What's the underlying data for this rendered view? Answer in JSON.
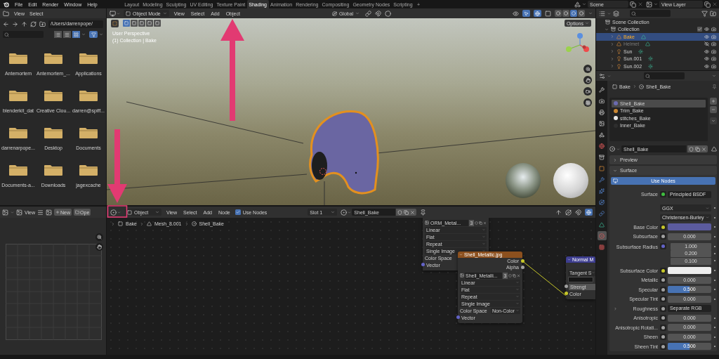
{
  "topbar": {
    "menu": [
      "File",
      "Edit",
      "Render",
      "Window",
      "Help"
    ],
    "workspaces": [
      {
        "label": "Layout",
        "selected": false
      },
      {
        "label": "Modeling",
        "selected": false
      },
      {
        "label": "Sculpting",
        "selected": false
      },
      {
        "label": "UV Editing",
        "selected": false
      },
      {
        "label": "Texture Paint",
        "selected": false
      },
      {
        "label": "Shading",
        "selected": true
      },
      {
        "label": "Animation",
        "selected": false
      },
      {
        "label": "Rendering",
        "selected": false
      },
      {
        "label": "Compositing",
        "selected": false
      },
      {
        "label": "Geometry Nodes",
        "selected": false
      },
      {
        "label": "Scripting",
        "selected": false
      }
    ],
    "add_workspace": "+",
    "scene": "Scene",
    "view_layer": "View Layer"
  },
  "file_browser": {
    "menu": [
      "View",
      "Select"
    ],
    "path": "/Users/darrenpope/",
    "display_modes": [
      {
        "selected": false
      },
      {
        "selected": false
      },
      {
        "selected": true
      }
    ],
    "filter_active": true,
    "items": [
      "Antemortem",
      "Antemortem_...",
      "Applications",
      "blenderkit_dat",
      "Creative Clou...",
      "darren@spiff...",
      "darrenarpope...",
      "Desktop",
      "Documents",
      "Documents-a...",
      "Downloads",
      "jagexcache"
    ]
  },
  "image_editor": {
    "menu": [
      "View"
    ],
    "new": "New",
    "open": "Ope"
  },
  "viewport": {
    "mode": "Object Mode",
    "menu": [
      "View",
      "Select",
      "Add",
      "Object"
    ],
    "orientation": "Global",
    "shading_modes": [
      {
        "selected": false
      },
      {
        "selected": false
      },
      {
        "selected": true
      },
      {
        "selected": false
      }
    ],
    "select_modes": [
      {
        "selected": true
      },
      {
        "selected": false
      },
      {
        "selected": false
      },
      {
        "selected": false
      },
      {
        "selected": false
      }
    ],
    "options": "Options",
    "info": [
      "User Perspective",
      "(1) Collection | Bake"
    ]
  },
  "node_editor": {
    "type": "Object",
    "menu": [
      "View",
      "Select",
      "Add",
      "Node"
    ],
    "use_nodes": {
      "label": "Use Nodes",
      "checked": true
    },
    "slot": "Slot 1",
    "material": "Shell_Bake",
    "breadcrumb": [
      "Bake",
      "Mesh_8.001",
      "Shell_Bake"
    ],
    "nodes": [
      {
        "rows": [
          {
            "kind": "image",
            "text": "ORM_Metal...",
            "users": "3"
          },
          {
            "kind": "dropdown",
            "text": "Linear"
          },
          {
            "kind": "dropdown",
            "text": "Flat"
          },
          {
            "kind": "dropdown",
            "text": "Repeat"
          },
          {
            "kind": "dropdown",
            "text": "Single Image"
          },
          {
            "kind": "label",
            "text": "Color Space"
          },
          {
            "kind": "input",
            "text": "Vector",
            "color": "#6363c7"
          }
        ]
      },
      {
        "title": "Shell_Metallic.jpg",
        "color": "#8c501e",
        "rows": [
          {
            "kind": "output",
            "text": "Color",
            "color": "#c7c729"
          },
          {
            "kind": "output",
            "text": "Alpha",
            "color": "#a1a1a1"
          },
          {
            "kind": "image",
            "text": "Shell_Metalli...",
            "users": "3"
          },
          {
            "kind": "dropdown",
            "text": "Linear"
          },
          {
            "kind": "dropdown",
            "text": "Flat"
          },
          {
            "kind": "dropdown",
            "text": "Repeat"
          },
          {
            "kind": "dropdown",
            "text": "Single Image"
          },
          {
            "kind": "field",
            "text": "Color Space",
            "value": "Non-Color"
          },
          {
            "kind": "input",
            "text": "Vector",
            "color": "#6363c7"
          }
        ]
      },
      {
        "title": "Normal M",
        "color": "#3d3d8f",
        "rows": [
          {
            "kind": "dropdown",
            "text": "Tangent S"
          },
          {
            "kind": "blank"
          },
          {
            "kind": "input_field",
            "text": "Strengt",
            "color": "#a1a1a1"
          },
          {
            "kind": "input",
            "text": "Color",
            "color": "#c7c729"
          }
        ]
      }
    ]
  },
  "outliner": {
    "items": [
      {
        "name": "Scene Collection",
        "kind": "scene",
        "selected": false,
        "children": [
          {
            "name": "Collection",
            "kind": "collection",
            "selected": false,
            "expanded": true,
            "visible": true,
            "children": [
              {
                "name": "Bake",
                "kind": "mesh",
                "selected": true,
                "expanded": false,
                "visible": true
              },
              {
                "name": "Helmet",
                "kind": "mesh",
                "selected": false,
                "expanded": false,
                "visible": false
              },
              {
                "name": "Sun",
                "kind": "light",
                "selected": false,
                "expanded": false,
                "visible": true
              },
              {
                "name": "Sun.001",
                "kind": "light",
                "selected": false,
                "expanded": false,
                "visible": true
              },
              {
                "name": "Sun.002",
                "kind": "light",
                "selected": false,
                "expanded": false,
                "visible": true
              }
            ]
          }
        ]
      }
    ]
  },
  "properties": {
    "tabs": [
      {
        "selected": false
      },
      {
        "selected": false
      },
      {
        "selected": false
      },
      {
        "selected": false
      },
      {
        "selected": false
      },
      {
        "selected": false
      },
      {
        "selected": false
      },
      {
        "selected": false
      },
      {
        "selected": false
      },
      {
        "selected": false
      },
      {
        "selected": false
      },
      {
        "selected": false
      },
      {
        "selected": false
      },
      {
        "selected": true
      },
      {
        "selected": false
      }
    ],
    "breadcrumb": [
      "Bake",
      "Shell_Bake"
    ],
    "slots": [
      {
        "name": "Shell_Bake",
        "color": "#6b6bb0",
        "selected": true
      },
      {
        "name": "Trim_Bake",
        "color": "#c98632",
        "selected": false
      },
      {
        "name": "stitches_Bake",
        "color": "#e6e6e6",
        "selected": false
      },
      {
        "name": "Inner_Bake",
        "color": "#2e2e2e",
        "selected": false
      }
    ],
    "material": "Shell_Bake",
    "panels": [
      {
        "title": "Preview",
        "expanded": false
      },
      {
        "title": "Surface",
        "expanded": true
      }
    ],
    "use_nodes": "Use Nodes",
    "rows": [
      {
        "kind": "link",
        "label": "Surface",
        "value": "Principled BSDF",
        "color": "#3fbf3f"
      },
      {
        "kind": "dropdown",
        "value": "GGX"
      },
      {
        "kind": "dropdown",
        "value": "Christensen-Burley"
      },
      {
        "kind": "color",
        "label": "Base Color",
        "color": "#c7c729",
        "swatch": {
          "color": "#5b5b9e"
        }
      },
      {
        "kind": "number",
        "label": "Subsurface",
        "value": "0.000",
        "color": "#a1a1a1"
      },
      {
        "kind": "vector",
        "label": "Subsurface Radius",
        "values": [
          "1.000",
          "0.200",
          "0.100"
        ],
        "color": "#6363c7"
      },
      {
        "kind": "color",
        "label": "Subsurface Color",
        "color": "#c7c729",
        "swatch": {
          "color": "#eeeeee"
        }
      },
      {
        "kind": "number",
        "label": "Metallic",
        "value": "0.000",
        "color": "#a1a1a1"
      },
      {
        "kind": "slider",
        "label": "Specular",
        "value": "0.500",
        "level": 0.5,
        "color": "#a1a1a1"
      },
      {
        "kind": "number",
        "label": "Specular Tint",
        "value": "0.000",
        "color": "#a1a1a1"
      },
      {
        "kind": "link",
        "label": "Roughness",
        "value": "Separate RGB",
        "color": "#a1a1a1"
      },
      {
        "kind": "number",
        "label": "Anisotropic",
        "value": "0.000",
        "color": "#a1a1a1"
      },
      {
        "kind": "number",
        "label": "Anisotropic Rotati...",
        "value": "0.000",
        "color": "#a1a1a1"
      },
      {
        "kind": "number",
        "label": "Sheen",
        "value": "0.000",
        "color": "#a1a1a1"
      },
      {
        "kind": "slider",
        "label": "Sheen Tint",
        "value": "0.500",
        "level": 0.5,
        "color": "#a1a1a1"
      }
    ]
  }
}
